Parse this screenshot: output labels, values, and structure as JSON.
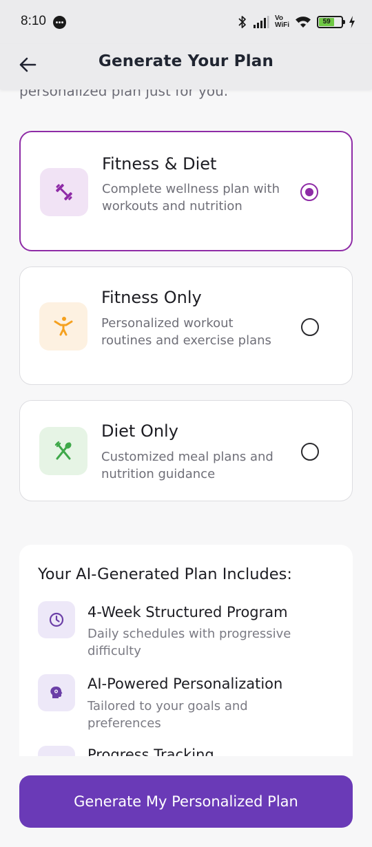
{
  "status_bar": {
    "time": "8:10",
    "network_label_top": "Vo",
    "network_label_bottom": "WiFi",
    "battery_level": "59",
    "icons": [
      "chat-bubble-icon",
      "bluetooth-icon",
      "signal-icon",
      "wifi-icon",
      "battery-icon",
      "charging-icon"
    ]
  },
  "header": {
    "title": "Generate Your Plan",
    "back_icon": "arrow-left-icon"
  },
  "intro": {
    "subtitle_tail": "personalized plan just for you."
  },
  "plans": [
    {
      "title": "Fitness & Diet",
      "description": "Complete wellness plan with workouts and nutrition",
      "icon": "dumbbell-icon",
      "icon_color": "#8e2ba6",
      "icon_bg": "#f1e3f5",
      "selected": true
    },
    {
      "title": "Fitness Only",
      "description": "Personalized workout routines and exercise plans",
      "icon": "exercise-figure-icon",
      "icon_color": "#f5a11f",
      "icon_bg": "#fdf1e1",
      "selected": false
    },
    {
      "title": "Diet Only",
      "description": "Customized meal plans and nutrition guidance",
      "icon": "fork-spoon-icon",
      "icon_color": "#3fa84a",
      "icon_bg": "#e6f4e5",
      "selected": false
    }
  ],
  "includes": {
    "title": "Your AI-Generated Plan Includes:",
    "features": [
      {
        "title": "4-Week Structured Program",
        "description": "Daily schedules with progressive difficulty",
        "icon": "clock-icon"
      },
      {
        "title": "AI-Powered Personalization",
        "description": "Tailored to your goals and preferences",
        "icon": "brain-head-icon"
      },
      {
        "title": "Progress Tracking",
        "description": "",
        "icon": "chart-icon"
      }
    ]
  },
  "cta": {
    "label": "Generate My Personalized Plan"
  },
  "colors": {
    "accent": "#8e2ba6",
    "button": "#6a3ab7",
    "feature_icon": "#6b3fa7"
  }
}
